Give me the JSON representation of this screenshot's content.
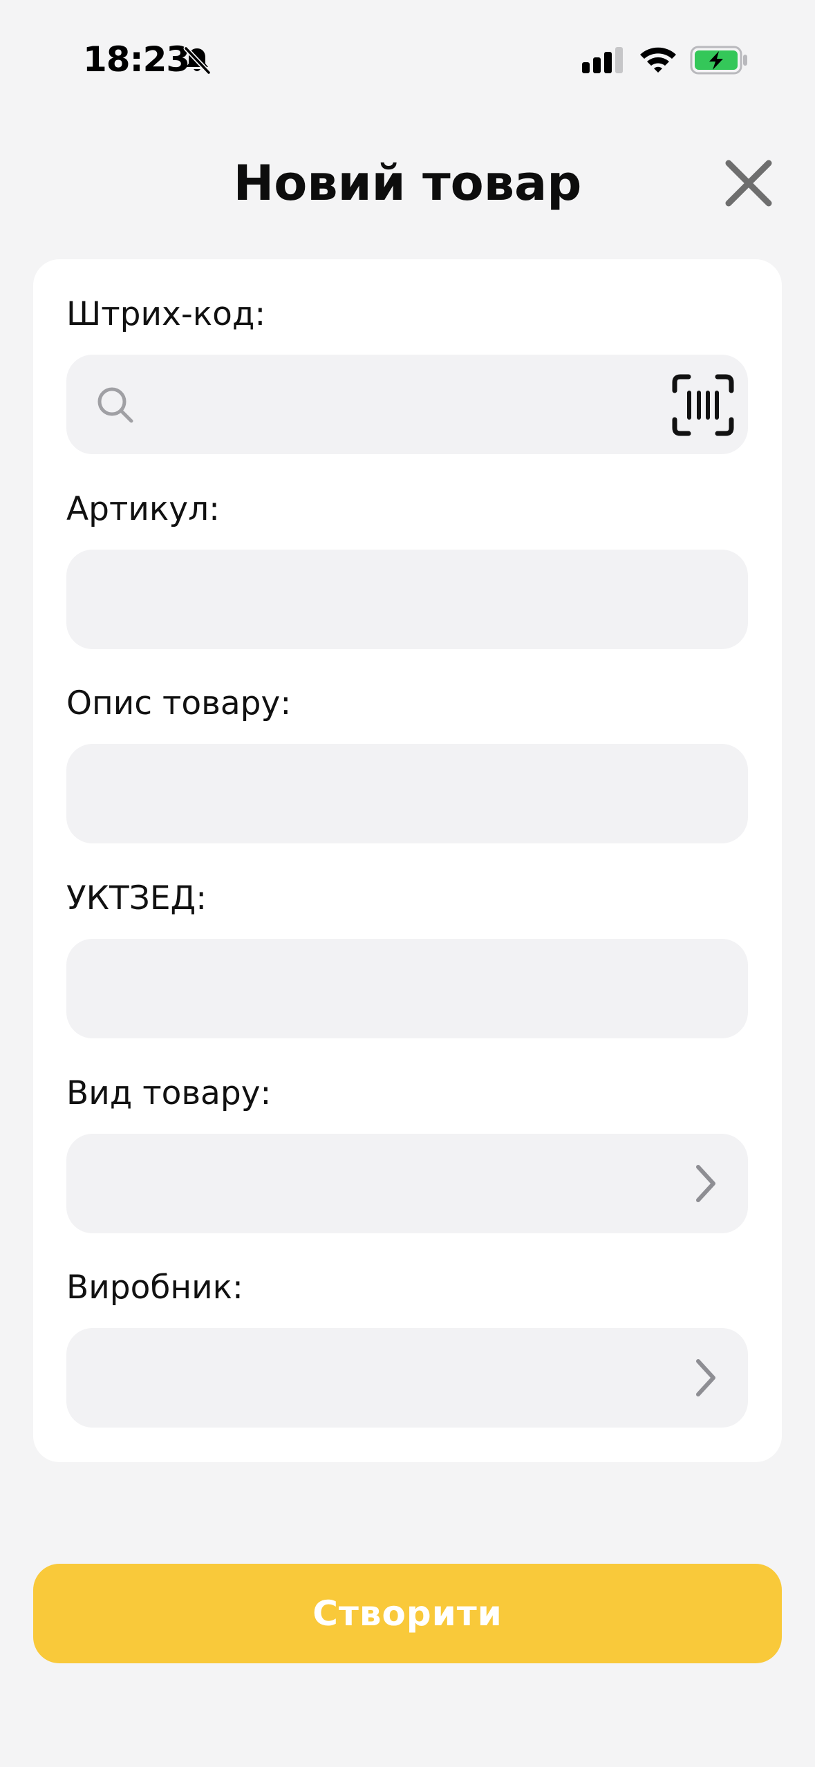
{
  "status_bar": {
    "time": "18:23",
    "icons": [
      "bell-slash-icon",
      "cellular-signal-icon",
      "wifi-icon",
      "battery-charging-icon"
    ],
    "battery_color": "#34c759"
  },
  "header": {
    "title": "Новий товар",
    "close_icon": "close-icon"
  },
  "form": {
    "fields": [
      {
        "label": "Штрих-код:",
        "value": "",
        "type": "search",
        "icons": [
          "search-icon",
          "barcode-scan-icon"
        ]
      },
      {
        "label": "Артикул:",
        "value": "",
        "type": "text"
      },
      {
        "label": "Опис товару:",
        "value": "",
        "type": "text"
      },
      {
        "label": "УКТЗЕД:",
        "value": "",
        "type": "text"
      },
      {
        "label": "Вид товару:",
        "value": "",
        "type": "select",
        "icons": [
          "chevron-right-icon"
        ]
      },
      {
        "label": "Виробник:",
        "value": "",
        "type": "select",
        "icons": [
          "chevron-right-icon"
        ]
      }
    ]
  },
  "actions": {
    "create_label": "Створити",
    "create_color": "#f9c93a"
  },
  "colors": {
    "background": "#f4f4f5",
    "card": "#ffffff",
    "input": "#f2f2f4",
    "accent": "#f9c93a"
  }
}
